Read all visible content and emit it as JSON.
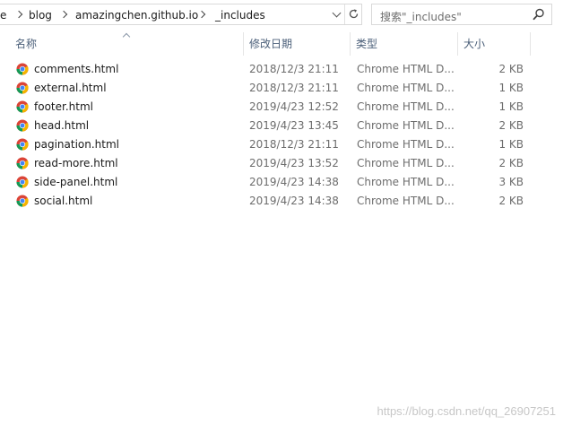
{
  "address": {
    "crumbs": [
      "e",
      "blog",
      "amazingchen.github.io",
      "_includes"
    ]
  },
  "search": {
    "placeholder": "搜索\"_includes\""
  },
  "columns": {
    "name": "名称",
    "date": "修改日期",
    "type": "类型",
    "size": "大小"
  },
  "files": [
    {
      "name": "comments.html",
      "date": "2018/12/3 21:11",
      "type": "Chrome HTML D...",
      "size": "2 KB"
    },
    {
      "name": "external.html",
      "date": "2018/12/3 21:11",
      "type": "Chrome HTML D...",
      "size": "1 KB"
    },
    {
      "name": "footer.html",
      "date": "2019/4/23 12:52",
      "type": "Chrome HTML D...",
      "size": "1 KB"
    },
    {
      "name": "head.html",
      "date": "2019/4/23 13:45",
      "type": "Chrome HTML D...",
      "size": "2 KB"
    },
    {
      "name": "pagination.html",
      "date": "2018/12/3 21:11",
      "type": "Chrome HTML D...",
      "size": "1 KB"
    },
    {
      "name": "read-more.html",
      "date": "2019/4/23 13:52",
      "type": "Chrome HTML D...",
      "size": "2 KB"
    },
    {
      "name": "side-panel.html",
      "date": "2019/4/23 14:38",
      "type": "Chrome HTML D...",
      "size": "3 KB"
    },
    {
      "name": "social.html",
      "date": "2019/4/23 14:38",
      "type": "Chrome HTML D...",
      "size": "2 KB"
    }
  ],
  "watermark": "https://blog.csdn.net/qq_26907251",
  "colors": {
    "header_text": "#4c607a",
    "chrome_red": "#db4437",
    "chrome_green": "#0f9d58",
    "chrome_yellow": "#f4b400",
    "chrome_blue": "#4285f4"
  },
  "icons": {
    "file": "chrome-html-icon",
    "refresh": "refresh-icon",
    "search": "search-icon"
  }
}
